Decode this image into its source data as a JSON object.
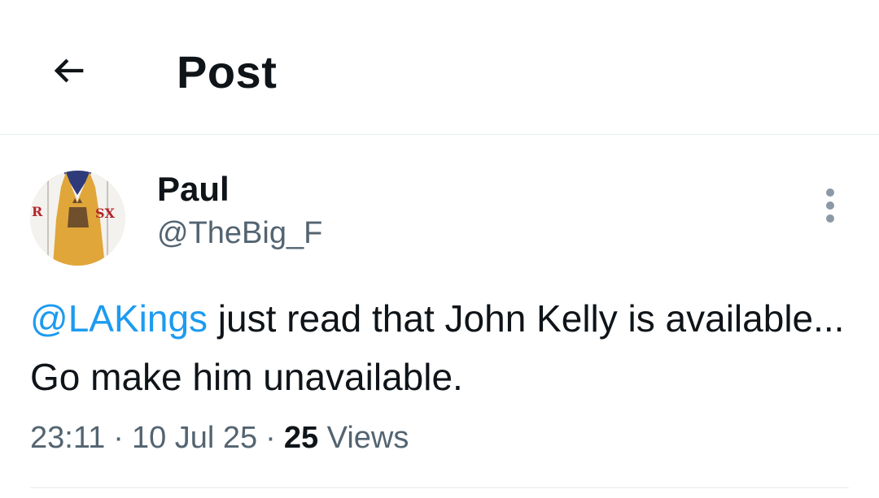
{
  "header": {
    "title": "Post",
    "back_icon": "arrow-left-icon"
  },
  "post": {
    "author": {
      "name": "Paul",
      "handle": "@TheBig_F",
      "avatar_icon": "jersey-avatar-image"
    },
    "text": {
      "mention": "@LAKings",
      "body": " just read that John Kelly is available... Go make him unavailable."
    },
    "meta": {
      "time": "23:11",
      "separator": "·",
      "date": "10 Jul 25",
      "views_count": "25",
      "views_label": "Views"
    },
    "more_icon": "more-vertical-icon"
  },
  "colors": {
    "accent": "#1d9bf0",
    "secondary_text": "#536471",
    "primary_text": "#0f1419",
    "divider": "#e6ecf0"
  }
}
